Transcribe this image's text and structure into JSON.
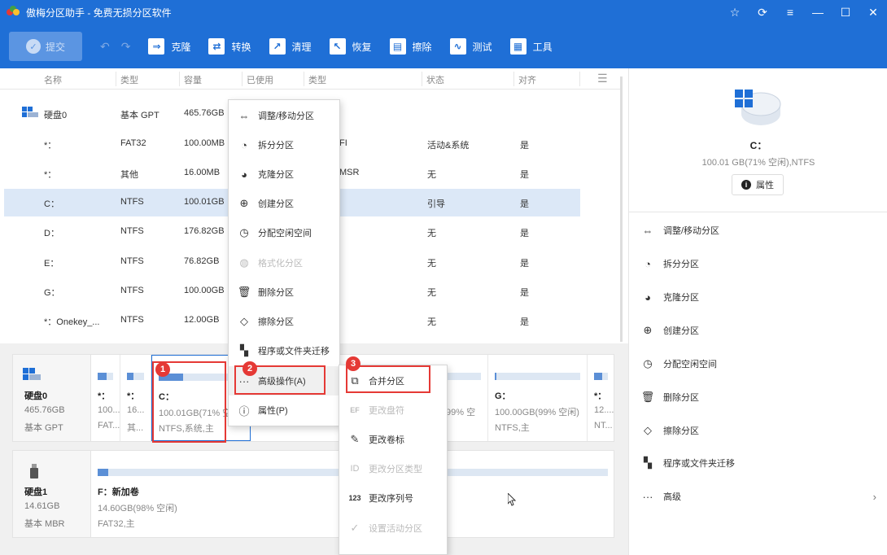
{
  "window": {
    "title": "傲梅分区助手 - 免费无损分区软件"
  },
  "toolbar": {
    "submit": "提交",
    "items": [
      {
        "label": "克隆",
        "icon": "clone-icon"
      },
      {
        "label": "转换",
        "icon": "convert-icon"
      },
      {
        "label": "清理",
        "icon": "clean-icon"
      },
      {
        "label": "恢复",
        "icon": "recover-icon"
      },
      {
        "label": "擦除",
        "icon": "wipe-icon"
      },
      {
        "label": "测试",
        "icon": "test-icon"
      },
      {
        "label": "工具",
        "icon": "tools-icon"
      }
    ]
  },
  "table": {
    "headers": [
      "名称",
      "类型",
      "容量",
      "已使用",
      "类型",
      "状态",
      "对齐"
    ],
    "disk0": {
      "name": "硬盘0",
      "type": "基本 GPT",
      "capacity": "465.76GB"
    },
    "rows": [
      {
        "name": "*：",
        "type": "FAT32",
        "cap": "100.00MB",
        "ftype": "FI",
        "status": "活动&系统",
        "align": "是"
      },
      {
        "name": "*：",
        "type": "其他",
        "cap": "16.00MB",
        "ftype": "MSR",
        "status": "无",
        "align": "是"
      },
      {
        "name": "C：",
        "type": "NTFS",
        "cap": "100.01GB",
        "ftype": "",
        "status": "引导",
        "align": "是"
      },
      {
        "name": "D：",
        "type": "NTFS",
        "cap": "176.82GB",
        "ftype": "",
        "status": "无",
        "align": "是"
      },
      {
        "name": "E：",
        "type": "NTFS",
        "cap": "76.82GB",
        "ftype": "",
        "status": "无",
        "align": "是"
      },
      {
        "name": "G：",
        "type": "NTFS",
        "cap": "100.00GB",
        "ftype": "",
        "status": "无",
        "align": "是"
      },
      {
        "name": "*：Onekey_...",
        "type": "NTFS",
        "cap": "12.00GB",
        "ftype": "",
        "status": "无",
        "align": "是"
      }
    ]
  },
  "diskmap": {
    "disk0": {
      "name": "硬盘0",
      "size": "465.76GB",
      "type": "基本 GPT"
    },
    "disk0_parts": [
      {
        "name": "*：",
        "size": "100...",
        "fs": "FAT...",
        "used": 0.6
      },
      {
        "name": "*：",
        "size": "16...",
        "fs": "其...",
        "used": 0.4
      },
      {
        "name": "C：",
        "size": "100.01GB(71% 空",
        "fs": "NTFS,系统,主",
        "used": 0.29
      },
      {
        "name": "",
        "size": "99% 空",
        "fs": "",
        "used": 0.02
      },
      {
        "name": "G：",
        "size": "100.00GB(99% 空闲)",
        "fs": "NTFS,主",
        "used": 0.02
      },
      {
        "name": "*：",
        "size": "12....",
        "fs": "NT...",
        "used": 0.6
      }
    ],
    "disk1": {
      "name": "硬盘1",
      "size": "14.61GB",
      "type": "基本 MBR"
    },
    "disk1_part": {
      "name": "F：新加卷",
      "size": "14.60GB(98% 空闲)",
      "fs": "FAT32,主",
      "used": 0.02
    }
  },
  "right_panel": {
    "selected_name": "C：",
    "selected_info": "100.01 GB(71% 空闲),NTFS",
    "properties_button": "属性",
    "actions": [
      {
        "label": "调整/移动分区",
        "icon": "resize-icon"
      },
      {
        "label": "拆分分区",
        "icon": "split-icon"
      },
      {
        "label": "克隆分区",
        "icon": "clone-partition-icon"
      },
      {
        "label": "创建分区",
        "icon": "create-partition-icon"
      },
      {
        "label": "分配空闲空间",
        "icon": "allocate-icon"
      },
      {
        "label": "删除分区",
        "icon": "delete-icon"
      },
      {
        "label": "擦除分区",
        "icon": "eraser-icon"
      },
      {
        "label": "程序或文件夹迁移",
        "icon": "migrate-icon"
      },
      {
        "label": "高级",
        "icon": "more-icon"
      }
    ]
  },
  "context_menu": {
    "items": [
      {
        "label": "调整/移动分区",
        "disabled": false
      },
      {
        "label": "拆分分区",
        "disabled": false
      },
      {
        "label": "克隆分区",
        "disabled": false
      },
      {
        "label": "创建分区",
        "disabled": false
      },
      {
        "label": "分配空闲空间",
        "disabled": false
      },
      {
        "label": "格式化分区",
        "disabled": true
      },
      {
        "label": "删除分区",
        "disabled": false
      },
      {
        "label": "擦除分区",
        "disabled": false
      },
      {
        "label": "程序或文件夹迁移",
        "disabled": false
      },
      {
        "label": "高级操作(A)",
        "disabled": false
      },
      {
        "label": "属性(P)",
        "disabled": false
      }
    ]
  },
  "submenu": {
    "items": [
      {
        "label": "合并分区",
        "disabled": false
      },
      {
        "label": "更改盘符",
        "disabled": true
      },
      {
        "label": "更改卷标",
        "disabled": false
      },
      {
        "label": "更改分区类型",
        "disabled": true
      },
      {
        "label": "更改序列号",
        "disabled": false
      },
      {
        "label": "设置活动分区",
        "disabled": true
      }
    ]
  },
  "annotations": [
    "1",
    "2",
    "3"
  ],
  "colors": {
    "accent": "#1f6fd6",
    "highlight_red": "#e53935",
    "selected_row": "#dce8f7"
  }
}
